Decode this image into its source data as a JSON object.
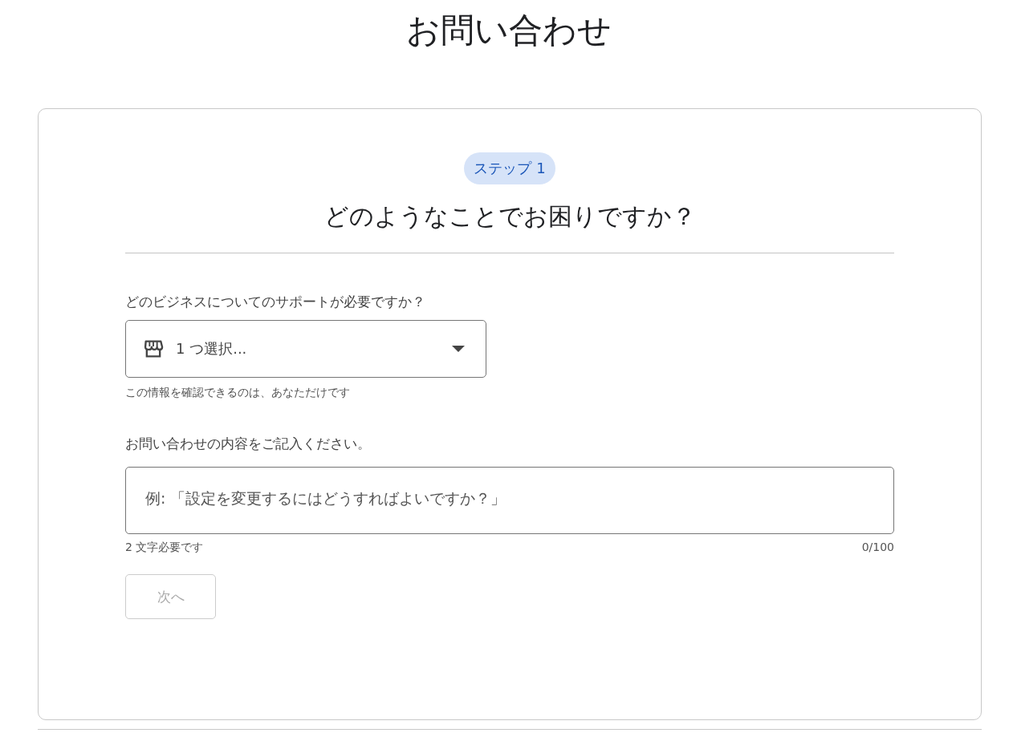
{
  "page_title": "お問い合わせ",
  "step": {
    "badge": "ステップ 1",
    "heading": "どのようなことでお困りですか？"
  },
  "business_field": {
    "label": "どのビジネスについてのサポートが必要ですか？",
    "value": "1 つ選択...",
    "helper": "この情報を確認できるのは、あなただけです"
  },
  "message_field": {
    "label": "お問い合わせの内容をご記入ください。",
    "placeholder": "例: 「設定を変更するにはどうすればよいですか？」",
    "helper": "2 文字必要です",
    "counter": "0/100"
  },
  "next_button": {
    "label": "次へ",
    "disabled": true
  }
}
